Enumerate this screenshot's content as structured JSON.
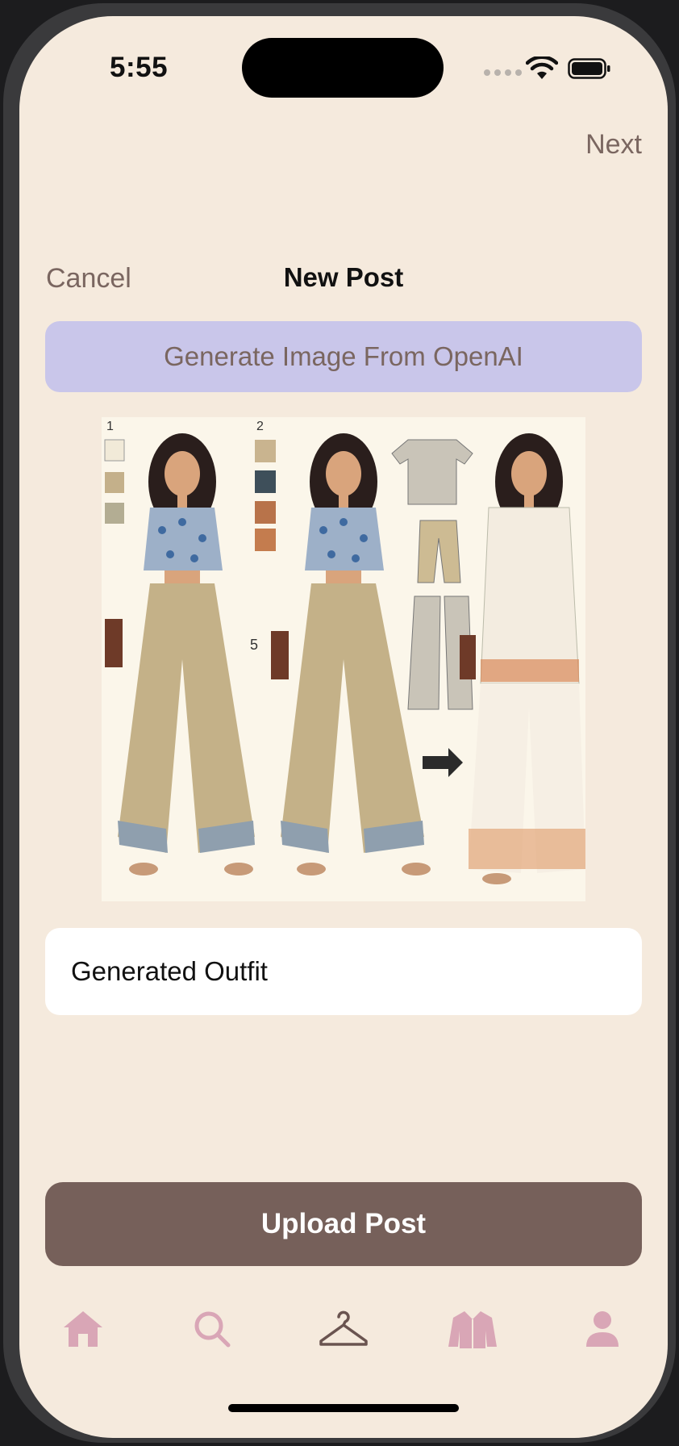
{
  "status_bar": {
    "time": "5:55"
  },
  "nav": {
    "next_label": "Next",
    "cancel_label": "Cancel",
    "title": "New Post"
  },
  "generate_button": {
    "label": "Generate Image From OpenAI"
  },
  "image": {
    "panel_numbers": [
      "1",
      "2",
      "5"
    ]
  },
  "caption_field": {
    "value": "Generated Outfit"
  },
  "upload_button": {
    "label": "Upload Post"
  },
  "tabs": [
    {
      "icon": "house-icon",
      "active": false
    },
    {
      "icon": "search-icon",
      "active": false
    },
    {
      "icon": "hanger-icon",
      "active": true
    },
    {
      "icon": "jacket-icon",
      "active": false
    },
    {
      "icon": "person-icon",
      "active": false
    }
  ],
  "colors": {
    "background": "#f5eadd",
    "accent_purple": "#c9c6ea",
    "primary_brown": "#76605a",
    "tab_inactive": "#d9a6b6",
    "tab_active": "#6a5450"
  }
}
